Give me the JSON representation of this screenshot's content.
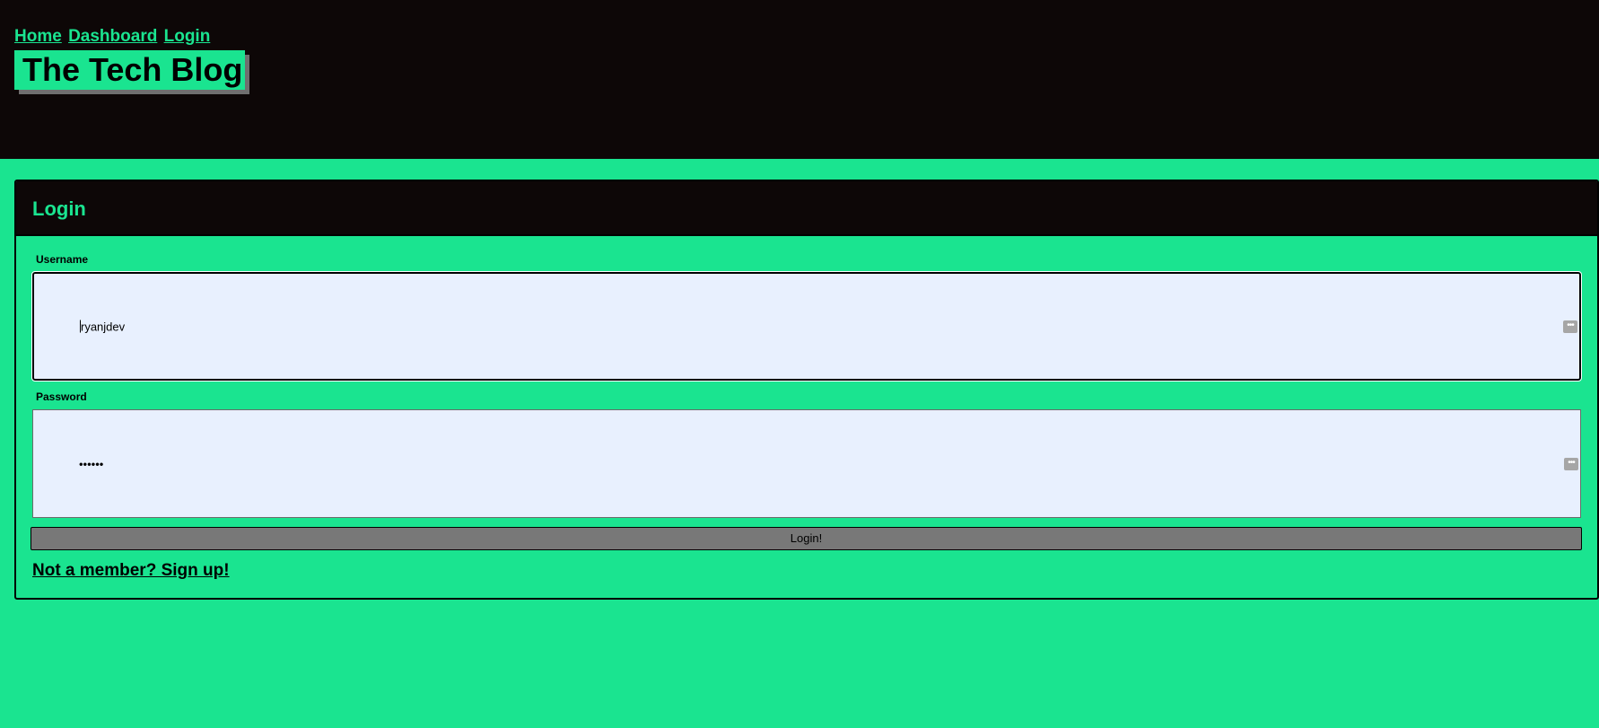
{
  "nav": {
    "home": "Home",
    "dashboard": "Dashboard",
    "login": "Login"
  },
  "site_title": "The Tech Blog",
  "login_card": {
    "heading": "Login",
    "username_label": "Username",
    "username_value": "ryanjdev",
    "password_label": "Password",
    "password_value": "••••••",
    "submit_label": "Login!",
    "signup_link": "Not a member? Sign up!"
  },
  "colors": {
    "accent": "#1ae490",
    "dark": "#0d0707",
    "input_bg": "#e8f0fe",
    "button": "#787878"
  },
  "icons": {
    "field_autofill": "more-horizontal-icon"
  }
}
